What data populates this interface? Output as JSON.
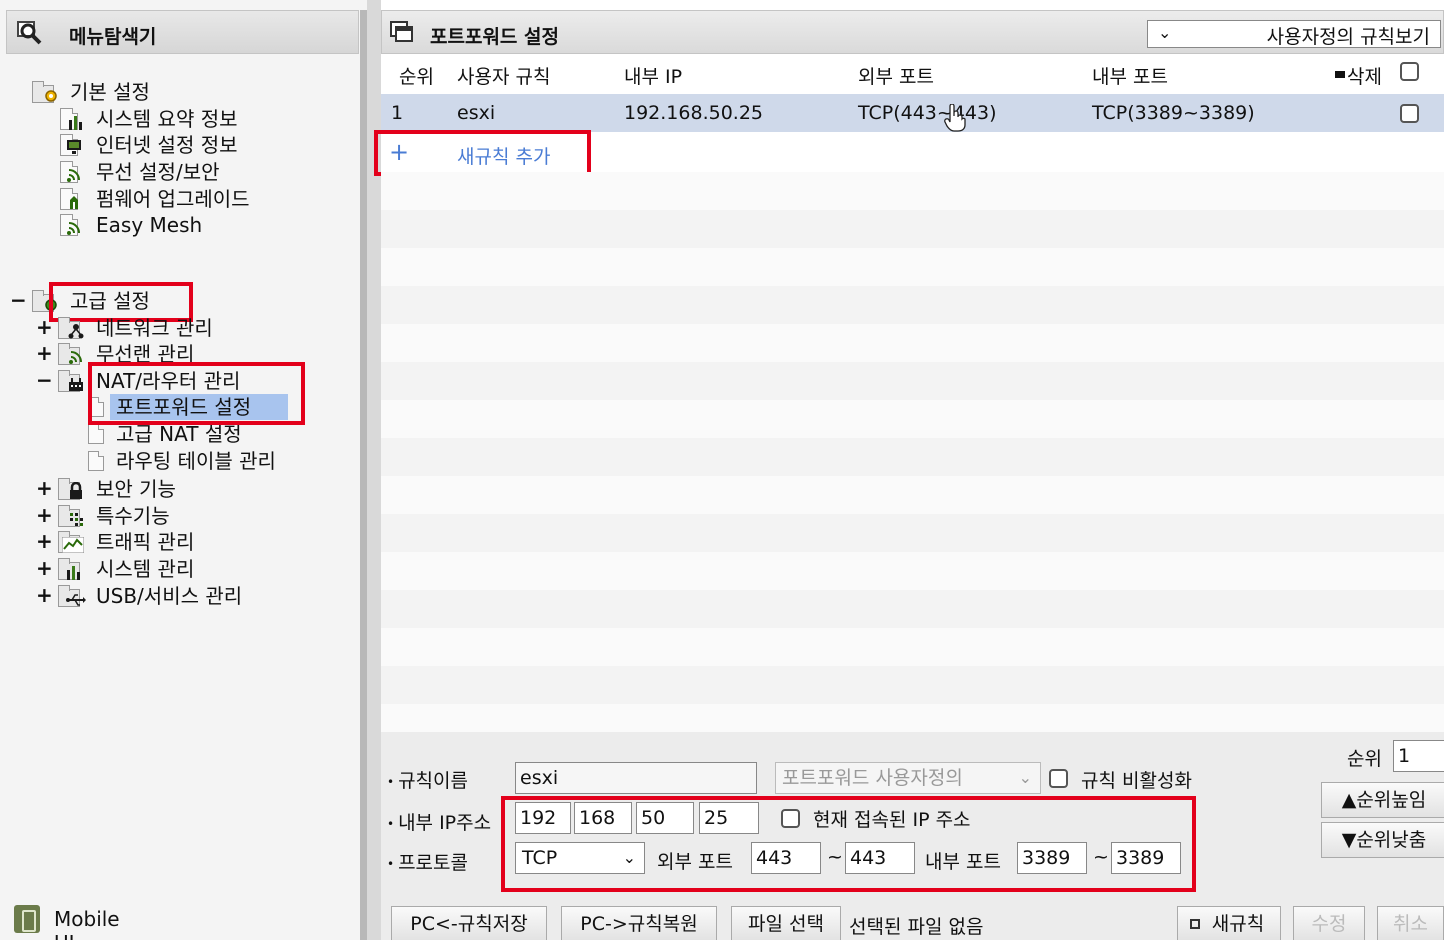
{
  "left_panel": {
    "title": "메뉴탐색기",
    "basic": {
      "label": "기본 설정",
      "items": [
        "시스템 요약 정보",
        "인터넷 설정 정보",
        "무선 설정/보안",
        "펌웨어 업그레이드",
        "Easy Mesh"
      ]
    },
    "advanced": {
      "label": "고급 설정",
      "items": [
        {
          "toggle": "+",
          "label": "네트워크 관리"
        },
        {
          "toggle": "+",
          "label": "무선랜 관리"
        },
        {
          "toggle": "−",
          "label": "NAT/라우터 관리"
        }
      ],
      "nat_children": [
        "포트포워드 설정",
        "고급 NAT 설정",
        "라우팅 테이블 관리"
      ],
      "more": [
        {
          "toggle": "+",
          "label": "보안 기능"
        },
        {
          "toggle": "+",
          "label": "특수기능"
        },
        {
          "toggle": "+",
          "label": "트래픽 관리"
        },
        {
          "toggle": "+",
          "label": "시스템 관리"
        },
        {
          "toggle": "+",
          "label": "USB/서비스 관리"
        }
      ],
      "toggle": "−"
    },
    "mobile_ui": "Mobile UI"
  },
  "right_panel": {
    "title": "포트포워드 설정",
    "view_select": "사용자정의 규칙보기",
    "columns": {
      "order": "순위",
      "rule": "사용자 규칙",
      "internal_ip": "내부 IP",
      "external_port": "외부 포트",
      "internal_port": "내부 포트",
      "delete": "삭제"
    },
    "rows": [
      {
        "order": "1",
        "rule": "esxi",
        "internal_ip": "192.168.50.25",
        "external_port": "TCP(443~443)",
        "internal_port": "TCP(3389~3389)"
      }
    ],
    "add_rule": "새규칙 추가"
  },
  "form": {
    "rule_name_label": "규칙이름",
    "rule_name_value": "esxi",
    "rule_type_select": "포트포워드 사용자정의",
    "disable_label": "규칙 비활성화",
    "internal_ip_label": "내부 IP주소",
    "ip": [
      "192",
      "168",
      "50",
      "25"
    ],
    "current_ip_label": "현재 접속된 IP 주소",
    "protocol_label": "프로토콜",
    "protocol_value": "TCP",
    "external_port_label": "외부 포트",
    "ext_port_from": "443",
    "ext_port_to": "443",
    "tilde": "~",
    "internal_port_label": "내부 포트",
    "int_port_from": "3389",
    "int_port_to": "3389",
    "order_label": "순위",
    "order_value": "1",
    "raise_label": "▲순위높임",
    "lower_label": "▼순위낮춤",
    "buttons": {
      "save_to_pc": "PC<-규칙저장",
      "restore_from_pc": "PC->규칙복원",
      "choose_file": "파일 선택",
      "no_file": "선택된 파일 없음",
      "new_rule": "새규칙",
      "modify": "수정",
      "cancel": "취소"
    }
  },
  "colors": {
    "highlight_red": "#e3001b",
    "selected_row": "#cfd9ea",
    "link_blue": "#4a7cd4",
    "tree_selection": "#a8c4ee"
  }
}
